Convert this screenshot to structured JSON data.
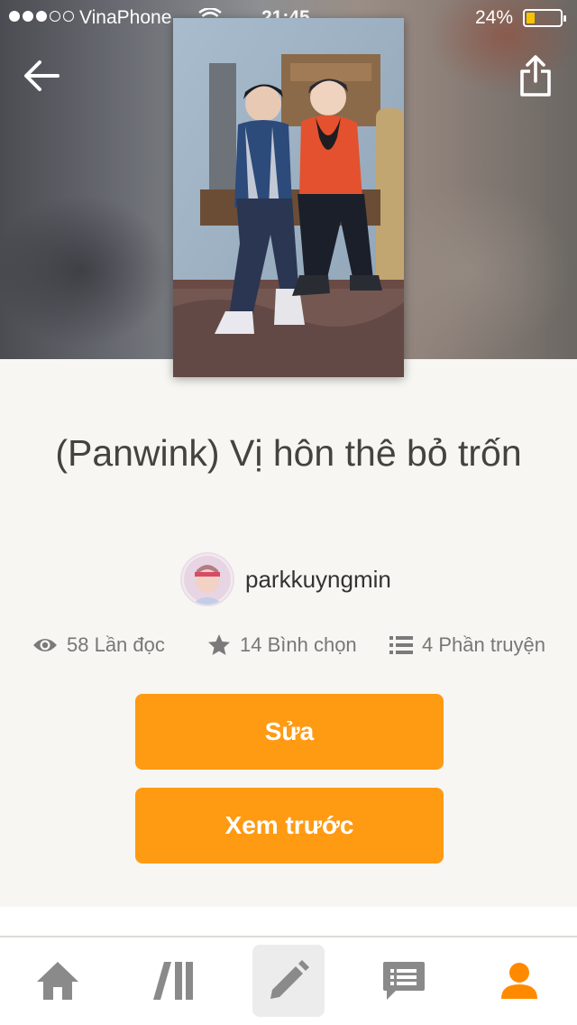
{
  "status_bar": {
    "carrier": "VinaPhone",
    "time": "21:45",
    "battery_percent": "24%",
    "battery_level": 0.24,
    "signal_bars_filled": 3,
    "signal_bars_total": 5
  },
  "story": {
    "title": "(Panwink) Vị hôn thê bỏ trốn",
    "author": "parkkuyngmin"
  },
  "stats": {
    "reads_label": "58 Lần đọc",
    "votes_label": "14 Bình chọn",
    "parts_label": "4 Phần truyện"
  },
  "actions": {
    "edit_label": "Sửa",
    "preview_label": "Xem trước"
  },
  "icons": {
    "back": "arrow-left-icon",
    "share": "share-icon",
    "reads": "eye-icon",
    "votes": "star-icon",
    "parts": "list-icon"
  },
  "tabs": [
    {
      "name": "home",
      "icon": "home-icon"
    },
    {
      "name": "library",
      "icon": "library-icon"
    },
    {
      "name": "write",
      "icon": "pencil-icon",
      "active": true
    },
    {
      "name": "messages",
      "icon": "chat-icon"
    },
    {
      "name": "profile",
      "icon": "profile-icon"
    }
  ],
  "colors": {
    "accent": "#ff9a13",
    "background": "#f7f6f2",
    "active_tab": "#ff8a00",
    "icon_grey": "#8a8a8a"
  }
}
